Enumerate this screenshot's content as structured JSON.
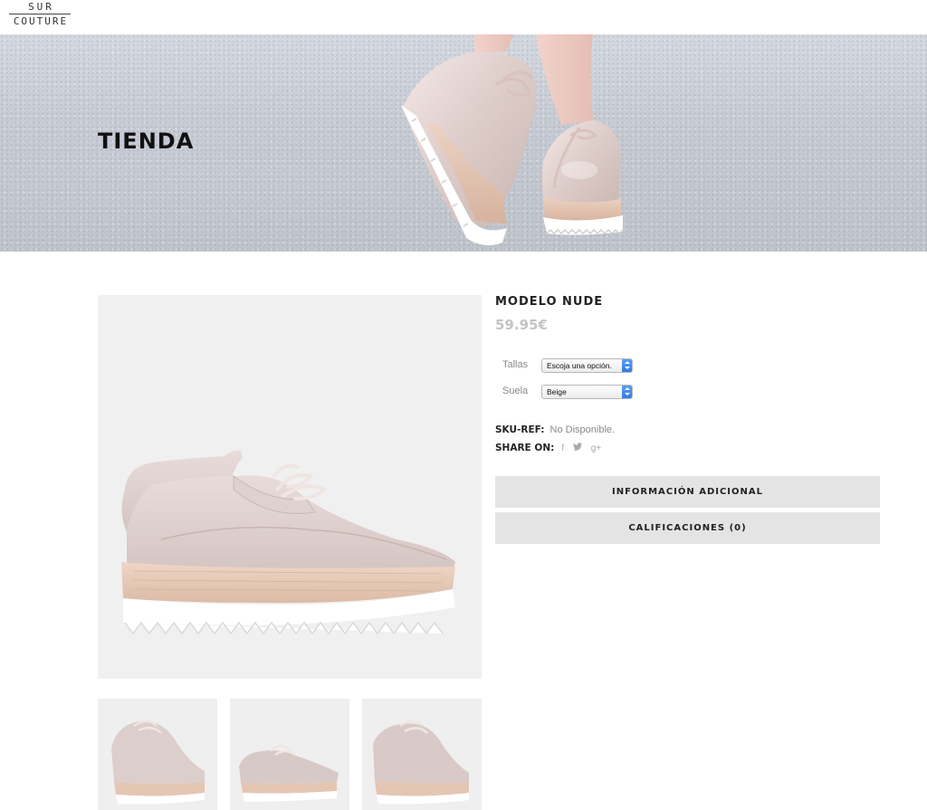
{
  "logo": {
    "line1": "SUR",
    "line2": "COUTURE"
  },
  "hero": {
    "title": "TIENDA"
  },
  "product": {
    "title": "MODELO NUDE",
    "price": "59.95€",
    "variations": [
      {
        "label": "Tallas",
        "selected": "Escoja una opción."
      },
      {
        "label": "Suela",
        "selected": "Beige"
      }
    ],
    "sku_label": "SKU-REF:",
    "sku_value": "No Disponible.",
    "share_label": "SHARE ON:",
    "share_icons": [
      "f",
      "t",
      "g+"
    ],
    "tabs": [
      {
        "label": "INFORMACIÓN ADICIONAL"
      },
      {
        "label": "CALIFICACIONES (0)"
      }
    ]
  },
  "colors": {
    "nude": "#d9c9c6",
    "sole_wood": "#dcbfae",
    "sole_white": "#ffffff",
    "price": "#c4c4c4",
    "tab_bg": "#e4e4e4",
    "select_accent": "#2f78e6"
  }
}
